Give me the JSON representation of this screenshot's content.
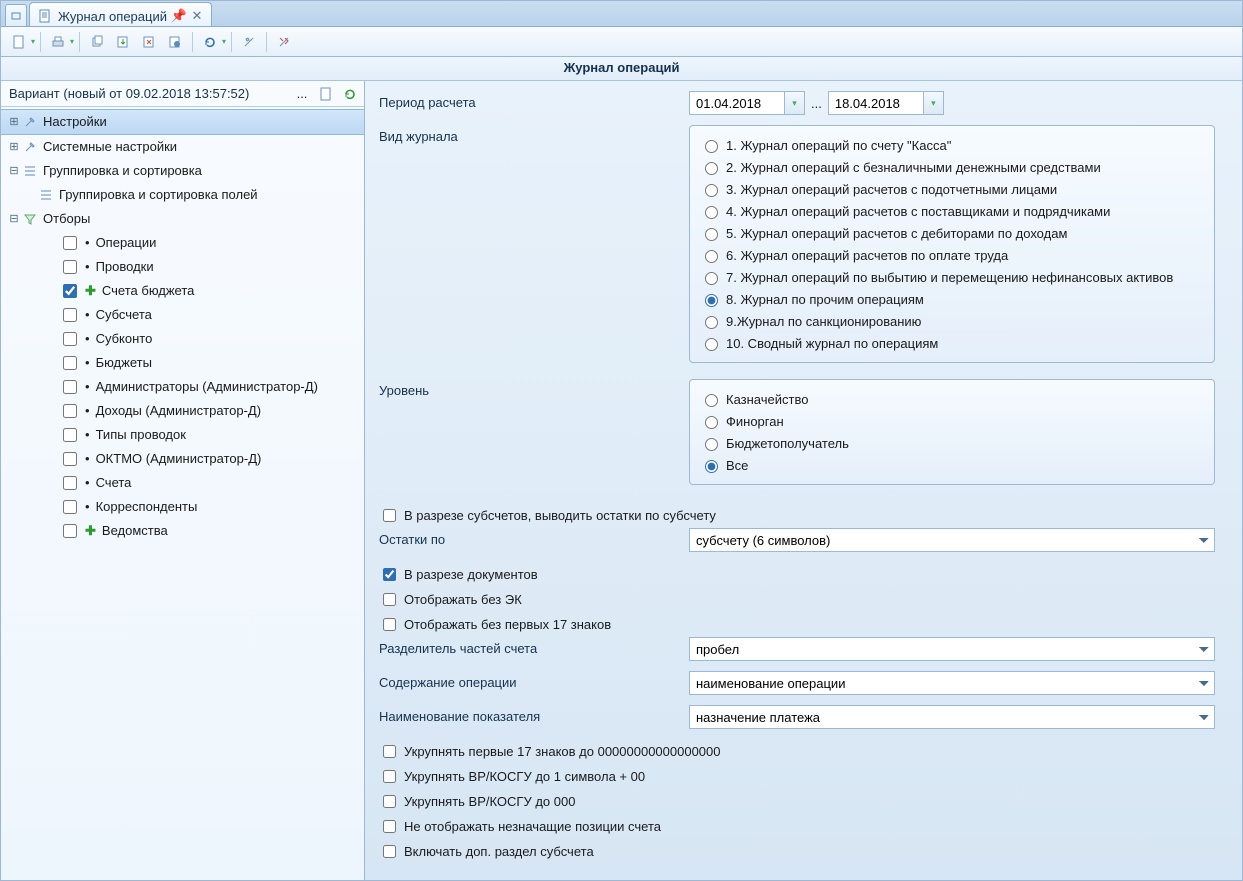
{
  "tab": {
    "title": "Журнал операций"
  },
  "page_title": "Журнал операций",
  "variant": {
    "label": "Вариант (новый от 09.02.2018 13:57:52)",
    "ellipsis": "..."
  },
  "tree": {
    "settings": "Настройки",
    "system_settings": "Системные настройки",
    "grouping": "Группировка и сортировка",
    "grouping_fields": "Группировка и сортировка полей",
    "filters": "Отборы",
    "filter_items": [
      {
        "label": "Операции",
        "checked": false,
        "kind": "bullet"
      },
      {
        "label": "Проводки",
        "checked": false,
        "kind": "bullet"
      },
      {
        "label": "Счета бюджета",
        "checked": true,
        "kind": "plus"
      },
      {
        "label": "Субсчета",
        "checked": false,
        "kind": "bullet"
      },
      {
        "label": "Субконто",
        "checked": false,
        "kind": "bullet"
      },
      {
        "label": "Бюджеты",
        "checked": false,
        "kind": "bullet"
      },
      {
        "label": "Администраторы (Администратор-Д)",
        "checked": false,
        "kind": "bullet"
      },
      {
        "label": "Доходы (Администратор-Д)",
        "checked": false,
        "kind": "bullet"
      },
      {
        "label": "Типы проводок",
        "checked": false,
        "kind": "bullet"
      },
      {
        "label": "ОКТМО (Администратор-Д)",
        "checked": false,
        "kind": "bullet"
      },
      {
        "label": "Счета",
        "checked": false,
        "kind": "bullet"
      },
      {
        "label": "Корреспонденты",
        "checked": false,
        "kind": "bullet"
      },
      {
        "label": "Ведомства",
        "checked": false,
        "kind": "plus"
      }
    ]
  },
  "form": {
    "period_label": "Период расчета",
    "date_from": "01.04.2018",
    "date_to": "18.04.2018",
    "journal_type_label": "Вид журнала",
    "journal_types": [
      "1. Журнал операций по счету \"Касса\"",
      "2. Журнал операций с безналичными денежными средствами",
      "3. Журнал операций расчетов с подотчетными лицами",
      "4. Журнал операций расчетов с поставщиками и подрядчиками",
      "5. Журнал операций расчетов с дебиторами по доходам",
      "6. Журнал операций расчетов по оплате труда",
      "7. Журнал операций по выбытию и перемещению нефинансовых активов",
      "8. Журнал по прочим операциям",
      "9.Журнал по санкционированию",
      "10. Сводный журнал по операциям"
    ],
    "journal_types_selected": 7,
    "level_label": "Уровень",
    "levels": [
      "Казначейство",
      "Финорган",
      "Бюджетополучатель",
      "Все"
    ],
    "levels_selected": 3,
    "chk_subaccounts": "В разрезе субсчетов, выводить остатки по субсчету",
    "balances_label": "Остатки по",
    "balances_value": "субсчету (6 символов)",
    "chk_by_docs": "В разрезе документов",
    "chk_no_ek": "Отображать без ЭК",
    "chk_no_first17": "Отображать без первых 17 знаков",
    "separator_label": "Разделитель частей счета",
    "separator_value": "пробел",
    "op_content_label": "Содержание операции",
    "op_content_value": "наименование операции",
    "indicator_label": "Наименование показателя",
    "indicator_value": "назначение платежа",
    "chk_enlarge17": "Укрупнять первые 17 знаков до 00000000000000000",
    "chk_vr1": "Укрупнять ВР/КОСГУ до 1 символа + 00",
    "chk_vr000": "Укрупнять ВР/КОСГУ до 000",
    "chk_hide_insignif": "Не отображать незначащие позиции счета",
    "chk_incl_addsub": "Включать доп. раздел субсчета"
  }
}
